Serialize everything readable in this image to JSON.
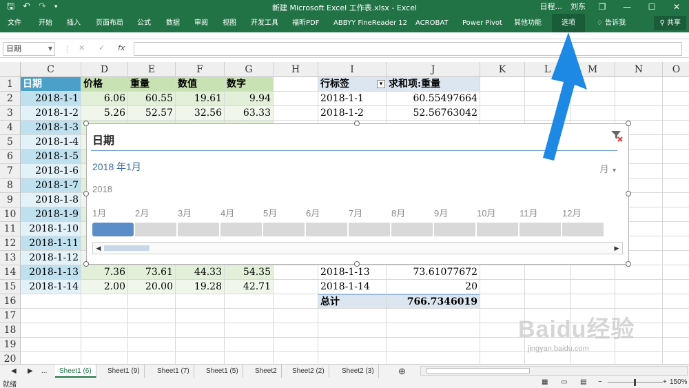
{
  "titlebar": {
    "doc_title": "新建 Microsoft Excel 工作表.xlsx  -  Excel",
    "schedule": "日程...",
    "user": "刘东",
    "restore": "❐",
    "minimize": "—",
    "maximize": "☐",
    "close": "✕"
  },
  "ribbon": {
    "tabs": [
      "文件",
      "开始",
      "插入",
      "页面布局",
      "公式",
      "数据",
      "审阅",
      "视图",
      "开发工具",
      "福昕PDF",
      "ABBYY FineReader 12",
      "ACROBAT",
      "Power Pivot",
      "其他功能",
      "选项"
    ],
    "tell_me": "告诉我",
    "share": "共享"
  },
  "formula_bar": {
    "name_box": "日期",
    "fx": "fx",
    "formula": ""
  },
  "columns": [
    "C",
    "D",
    "E",
    "F",
    "G",
    "H",
    "I",
    "J",
    "K",
    "L",
    "M",
    "N",
    "O"
  ],
  "rows": [
    "1",
    "2",
    "3",
    "4",
    "5",
    "6",
    "7",
    "8",
    "9",
    "10",
    "11",
    "12",
    "13",
    "14",
    "15",
    "16",
    "17",
    "18",
    "19",
    "20"
  ],
  "table": {
    "headers": [
      "日期",
      "价格",
      "重量",
      "数值",
      "数字"
    ],
    "rows": [
      [
        "2018-1-1",
        "6.06",
        "60.55",
        "19.61",
        "9.94"
      ],
      [
        "2018-1-2",
        "5.26",
        "52.57",
        "32.56",
        "63.33"
      ],
      [
        "2018-1-3",
        "",
        "",
        "",
        ""
      ],
      [
        "2018-1-4",
        "",
        "",
        "",
        ""
      ],
      [
        "2018-1-5",
        "",
        "",
        "",
        ""
      ],
      [
        "2018-1-6",
        "",
        "",
        "",
        ""
      ],
      [
        "2018-1-7",
        "",
        "",
        "",
        ""
      ],
      [
        "2018-1-8",
        "",
        "",
        "",
        ""
      ],
      [
        "2018-1-9",
        "",
        "",
        "",
        ""
      ],
      [
        "2018-1-10",
        "",
        "",
        "",
        ""
      ],
      [
        "2018-1-11",
        "",
        "",
        "",
        ""
      ],
      [
        "2018-1-12",
        "",
        "",
        "",
        ""
      ],
      [
        "2018-1-13",
        "7.36",
        "73.61",
        "44.33",
        "54.35"
      ],
      [
        "2018-1-14",
        "2.00",
        "20.00",
        "19.28",
        "42.71"
      ]
    ]
  },
  "pivot": {
    "row_label": "行标签",
    "value_label": "求和项:重量",
    "rows": [
      [
        "2018-1-1",
        "60.55497664"
      ],
      [
        "2018-1-2",
        "52.56763042"
      ],
      [
        "2018-1-13",
        "73.61077672"
      ],
      [
        "2018-1-14",
        "20"
      ]
    ],
    "total_label": "总计",
    "total_value": "766.7346019"
  },
  "timeline": {
    "title": "日期",
    "selection": "2018 年1月",
    "level": "月",
    "year": "2018",
    "months": [
      "1月",
      "2月",
      "3月",
      "4月",
      "5月",
      "6月",
      "7月",
      "8月",
      "9月",
      "10月",
      "11月",
      "12月"
    ],
    "selected_month_index": 0
  },
  "sheets": {
    "tabs": [
      "Sheet1 (6)",
      "Sheet1 (9)",
      "Sheet1 (7)",
      "Sheet1 (5)",
      "Sheet2",
      "Sheet2 (2)",
      "Sheet2 (3)"
    ],
    "active_index": 0,
    "more": "...",
    "add": "⊕"
  },
  "statusbar": {
    "ready": "就绪",
    "zoom": "150%"
  },
  "watermark": {
    "main": "Baidu经验",
    "sub": "jingyan.baidu.com"
  },
  "colors": {
    "excel_green": "#217346",
    "arrow_blue": "#1e88e5"
  }
}
